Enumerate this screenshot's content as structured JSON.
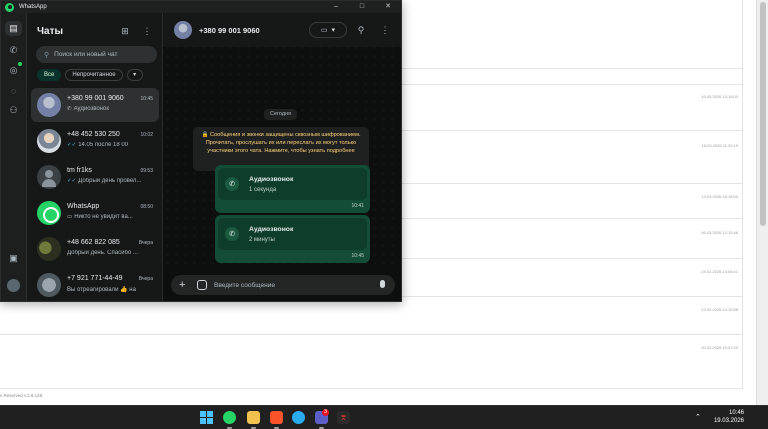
{
  "window": {
    "title": "WhatsApp",
    "controls": [
      "–",
      "□",
      "✕"
    ]
  },
  "rail": {
    "items": [
      "chats-icon",
      "calls-icon",
      "status-icon",
      "channels-icon",
      "communities-icon"
    ],
    "bottom": [
      "media-icon",
      "profile-avatar"
    ]
  },
  "chat_list": {
    "title": "Чаты",
    "search_placeholder": "Поиск или новый чат",
    "filters": [
      "Все",
      "Непрочитанное"
    ],
    "chats": [
      {
        "name": "+380 99 001 9060",
        "time": "10:45",
        "preview_icon": "✆",
        "preview": "Аудиозвонок",
        "selected": true
      },
      {
        "name": "+48 452 530 250",
        "time": "10:02",
        "preview_icon": "✓✓",
        "preview": "14.05 после 18 00",
        "selected": false
      },
      {
        "name": "tm fr1ks",
        "time": "09:53",
        "preview_icon": "✓✓",
        "preview": "Добрый день провел...",
        "selected": false
      },
      {
        "name": "WhatsApp",
        "time": "08:50",
        "preview_icon": "▭",
        "preview": "Никто не увидит ва...",
        "selected": false
      },
      {
        "name": "+48 662 822 085",
        "time": "Вчера",
        "preview_icon": "",
        "preview": "Добрый день. Спасибо ...",
        "selected": false
      },
      {
        "name": "+7 921 771-44-49",
        "time": "Вчера",
        "preview_icon": "",
        "preview": "Вы отреагировали 👍 на",
        "selected": false
      }
    ]
  },
  "conversation": {
    "contact": "+380 99 001 9060",
    "date_chip": "Сегодня",
    "encryption_notice": "🔒 Сообщения и звонки защищены сквозным шифрованием. Прочитать, прослушать их или переслать их могут только участники этого чата. Нажмите, чтобы узнать подробнее",
    "messages": [
      {
        "title": "Аудиозвонок",
        "subtitle": "1 секунда",
        "time": "10:41"
      },
      {
        "title": "Аудиозвонок",
        "subtitle": "2 минуты",
        "time": "10:45"
      }
    ],
    "composer_placeholder": "Введите сообщение"
  },
  "background_page": {
    "dates": [
      "16.05.2026 13:15:00",
      "16.03.2026 11:30:19",
      "13.03.2026 15:18:00",
      "06.03.2026 12:15:46",
      "24.02.2026 14:06:41",
      "23.02.2026 14:10:58",
      "20.02.2026 10:47:29"
    ],
    "footer": "s Reserved v.2.6.129"
  },
  "taskbar": {
    "apps": [
      "windows-start",
      "whatsapp",
      "file-explorer",
      "brave-browser",
      "telegram",
      "teams",
      "pdf-reader"
    ],
    "teams_badge": "3",
    "time": "10:46",
    "date": "19.03.2026"
  },
  "colors": {
    "accent": "#25d366",
    "bubble": "#134d37",
    "panel": "#161717",
    "notice": "#ffd279"
  }
}
